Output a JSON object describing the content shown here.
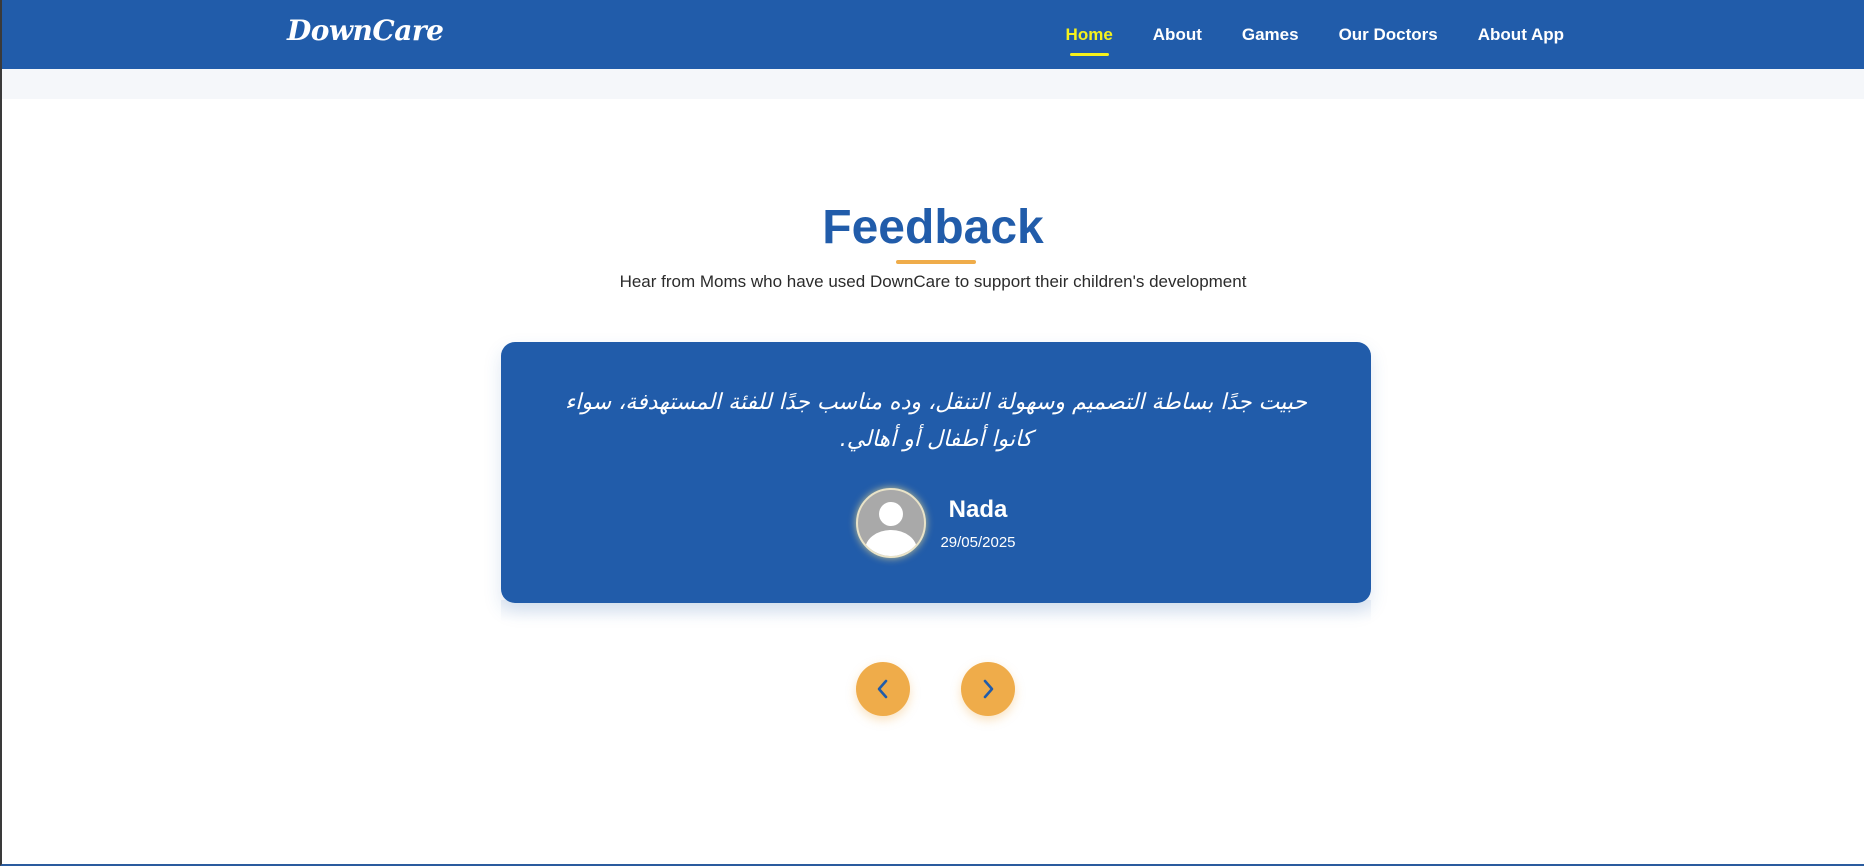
{
  "header": {
    "logo": "DownCare",
    "nav": [
      {
        "label": "Home",
        "active": true
      },
      {
        "label": "About",
        "active": false
      },
      {
        "label": "Games",
        "active": false
      },
      {
        "label": "Our Doctors",
        "active": false
      },
      {
        "label": "About App",
        "active": false
      }
    ]
  },
  "feedback": {
    "title": "Feedback",
    "subtitle": "Hear from Moms who have used DownCare to support their children's development",
    "testimonial": {
      "quote": "حبيت جدًا بساطة التصميم وسهولة التنقل، وده مناسب جدًا للفئة المستهدفة، سواء كانوا أطفال أو أهالي.",
      "name": "Nada",
      "date": "29/05/2025"
    },
    "controls": {
      "prev_icon": "chevron-left-icon",
      "next_icon": "chevron-right-icon"
    }
  },
  "colors": {
    "primary": "#215caa",
    "accent": "#efac4a",
    "active_nav": "#f5f11c"
  }
}
